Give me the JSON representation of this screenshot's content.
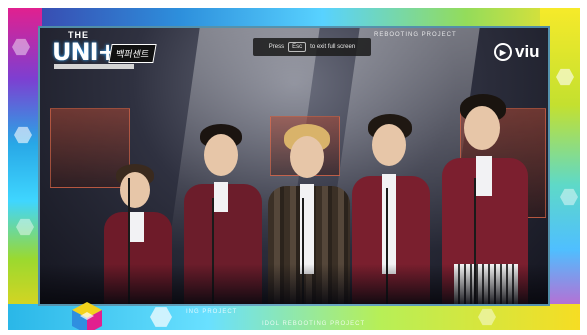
{
  "logo": {
    "the": "THE",
    "unit": "UNI+",
    "badge": "백퍼센트"
  },
  "banners": {
    "top": "REBOOTING PROJECT",
    "bottom_center": "IDOL REBOOTING PROJECT",
    "bottom_left": "ING PROJECT"
  },
  "fullscreen_tip": {
    "prefix": "Press",
    "key": "Esc",
    "suffix": "to exit full screen"
  },
  "watermark": {
    "brand": "viu"
  },
  "colors": {
    "frame_magenta": "#e1208f",
    "frame_cyan": "#3fd6ff",
    "frame_yellow": "#f6ea2a",
    "jacket_burgundy": "#7a1f2e"
  }
}
